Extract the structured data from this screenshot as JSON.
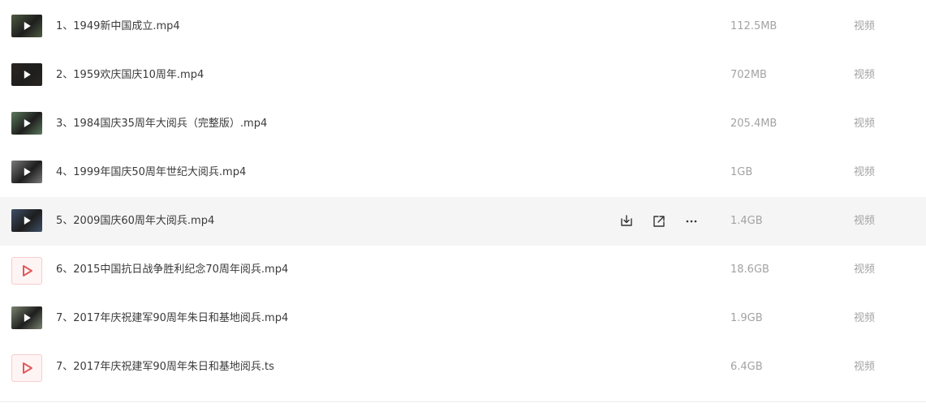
{
  "files": [
    {
      "name": "1、1949新中国成立.mp4",
      "size": "112.5MB",
      "type": "视频",
      "thumb": "video-frame",
      "thumb_color": "#4d5a3f"
    },
    {
      "name": "2、1959欢庆国庆10周年.mp4",
      "size": "702MB",
      "type": "视频",
      "thumb": "video-frame",
      "thumb_color": "#2a2520"
    },
    {
      "name": "3、1984国庆35周年大阅兵（完整版）.mp4",
      "size": "205.4MB",
      "type": "视频",
      "thumb": "video-frame",
      "thumb_color": "#5b7a5c"
    },
    {
      "name": "4、1999年国庆50周年世纪大阅兵.mp4",
      "size": "1GB",
      "type": "视频",
      "thumb": "video-frame",
      "thumb_color": "#7b7b7b"
    },
    {
      "name": "5、2009国庆60周年大阅兵.mp4",
      "size": "1.4GB",
      "type": "视频",
      "thumb": "video-frame",
      "thumb_color": "#3f5068"
    },
    {
      "name": "6、2015中国抗日战争胜利纪念70周年阅兵.mp4",
      "size": "18.6GB",
      "type": "视频",
      "thumb": "video-file-icon",
      "thumb_color": "#e05a5a"
    },
    {
      "name": "7、2017年庆祝建军90周年朱日和基地阅兵.mp4",
      "size": "1.9GB",
      "type": "视频",
      "thumb": "video-frame",
      "thumb_color": "#7a8470"
    },
    {
      "name": "7、2017年庆祝建军90周年朱日和基地阅兵.ts",
      "size": "6.4GB",
      "type": "视频",
      "thumb": "video-file-icon",
      "thumb_color": "#e05a5a"
    }
  ],
  "hovered_row": 4,
  "hover_actions": [
    "download-icon",
    "share-icon",
    "more-icon"
  ],
  "colors": {
    "text": "#3a3a3a",
    "muted": "#a3a3a3",
    "hover_bg": "#f5f5f6",
    "play_red": "#e05a5a"
  }
}
